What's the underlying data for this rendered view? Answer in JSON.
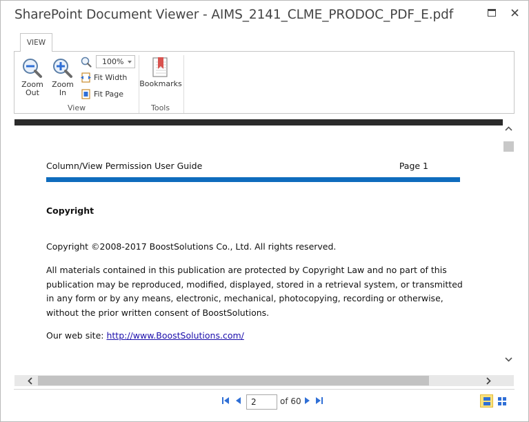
{
  "window": {
    "title": "SharePoint Document Viewer - AIMS_2141_CLME_PRODOC_PDF_E.pdf"
  },
  "ribbon": {
    "tab_label": "VIEW",
    "zoom_out_line1": "Zoom",
    "zoom_out_line2": "Out",
    "zoom_in_line1": "Zoom",
    "zoom_in_line2": "In",
    "zoom_value": "100%",
    "fit_width_label": "Fit Width",
    "fit_page_label": "Fit Page",
    "view_group_label": "View",
    "bookmarks_label": "Bookmarks",
    "tools_group_label": "Tools"
  },
  "document": {
    "header_title": "Column/View Permission User Guide",
    "header_page": "Page 1",
    "heading": "Copyright",
    "copyright_line": "Copyright ©2008-2017 BoostSolutions Co., Ltd. All rights reserved.",
    "paragraph": "All materials contained in this publication are protected by Copyright Law and no part of this publication may be reproduced, modified, displayed, stored in a retrieval system, or transmitted in any form or by any means, electronic, mechanical, photocopying, recording or otherwise, without the prior written consent of BoostSolutions.",
    "website_prefix": "Our web site: ",
    "website_url": "http://www.BoostSolutions.com/"
  },
  "pager": {
    "current_page": "2",
    "of_label": "of 60"
  },
  "colors": {
    "accent_blue": "#0f6cbd",
    "nav_blue": "#2f6fd6",
    "active_view_bg": "#fbe27c"
  }
}
